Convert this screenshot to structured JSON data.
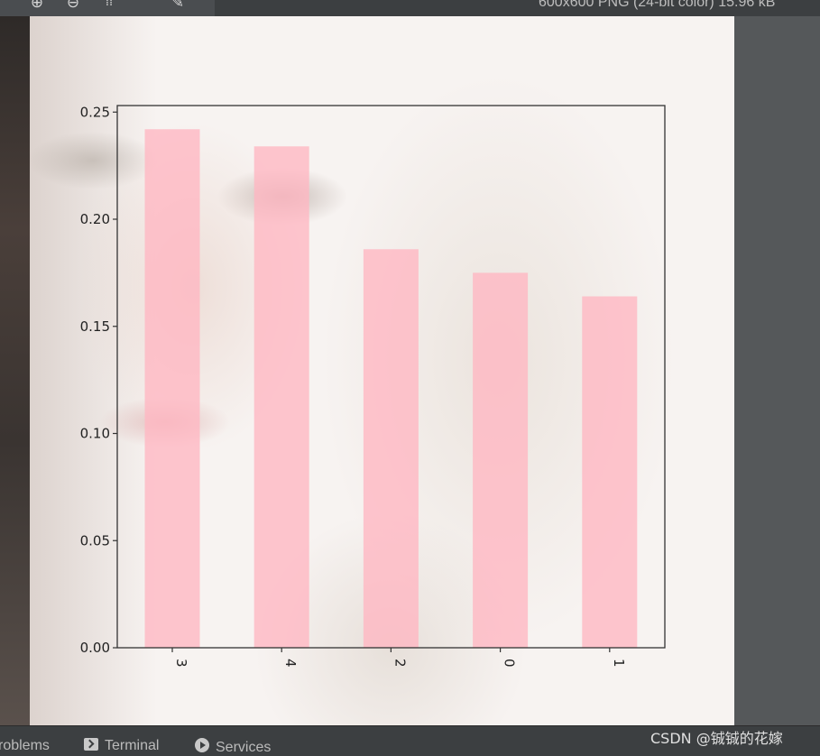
{
  "toolbar": {
    "icons": [
      "zoom-in-icon",
      "zoom-out-icon",
      "grid-icon",
      "color-picker-icon"
    ],
    "image_info": "600x600 PNG (24-bit color) 15.96 kB"
  },
  "bottom_bar": {
    "items": [
      {
        "label": "roblems",
        "icon": "problems-icon"
      },
      {
        "label": "Terminal",
        "icon": "terminal-icon"
      },
      {
        "label": "Services",
        "icon": "services-icon"
      }
    ]
  },
  "watermark": "CSDN @铖铖的花嫁",
  "colors": {
    "bar": "#ffb6c1",
    "ide_background": "#3c3f41",
    "panel": "#55585a"
  },
  "chart_data": {
    "type": "bar",
    "categories": [
      "3",
      "4",
      "2",
      "0",
      "1"
    ],
    "values": [
      0.242,
      0.234,
      0.186,
      0.175,
      0.164
    ],
    "ylim": [
      0,
      0.255
    ],
    "yticks": [
      0.0,
      0.05,
      0.1,
      0.15,
      0.2,
      0.25
    ],
    "ytick_labels": [
      "0.00",
      "0.05",
      "0.10",
      "0.15",
      "0.20",
      "0.25"
    ],
    "xtick_rotation": "vertical",
    "grid": false,
    "title": "",
    "xlabel": "",
    "ylabel": ""
  }
}
